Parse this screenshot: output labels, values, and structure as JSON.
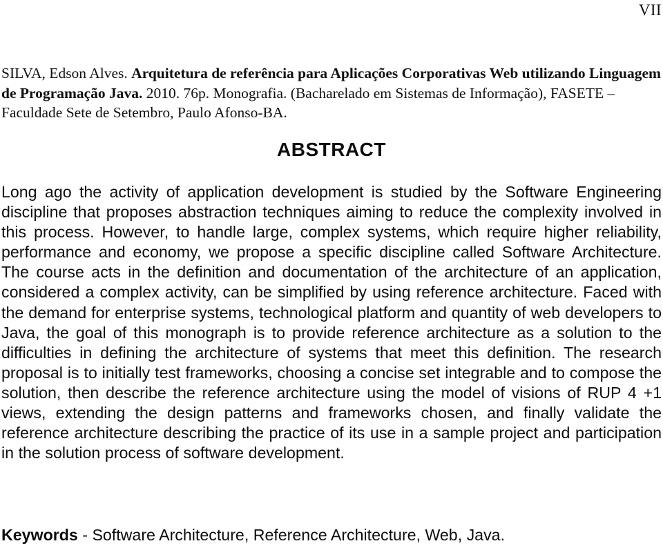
{
  "document": {
    "page_number": "VII",
    "citation": {
      "author": "SILVA, Edson Alves.",
      "title": "Arquitetura de referência para Aplicações Corporativas Web utilizando Linguagem de Programação Java.",
      "details": "2010. 76p. Monografia. (Bacharelado em Sistemas de Informação), FASETE – Faculdade Sete de Setembro, Paulo Afonso-BA."
    },
    "abstract": {
      "heading": "ABSTRACT",
      "body": "Long ago the activity of application development is studied by the Software Engineering discipline that proposes abstraction techniques aiming to reduce the complexity involved in this process. However, to handle large, complex systems, which require higher reliability, performance and economy, we propose a specific discipline called Software Architecture. The course acts in the definition and documentation of the architecture of an application, considered a complex activity, can be simplified by using reference architecture. Faced with the demand for enterprise systems, technological platform and quantity of web developers to Java, the goal of this monograph is to provide reference architecture as a solution to the difficulties in defining the architecture of systems that meet this definition. The research proposal is to initially test frameworks, choosing a concise set integrable and to compose the solution, then describe the reference architecture using the model of visions of RUP 4 +1 views, extending the design patterns and frameworks chosen, and finally validate the reference architecture describing the practice of its use in a sample project and participation in the solution process of software development."
    },
    "keywords": {
      "label": "Keywords",
      "separator": " - ",
      "text": "Software Architecture, Reference Architecture, Web, Java."
    }
  }
}
